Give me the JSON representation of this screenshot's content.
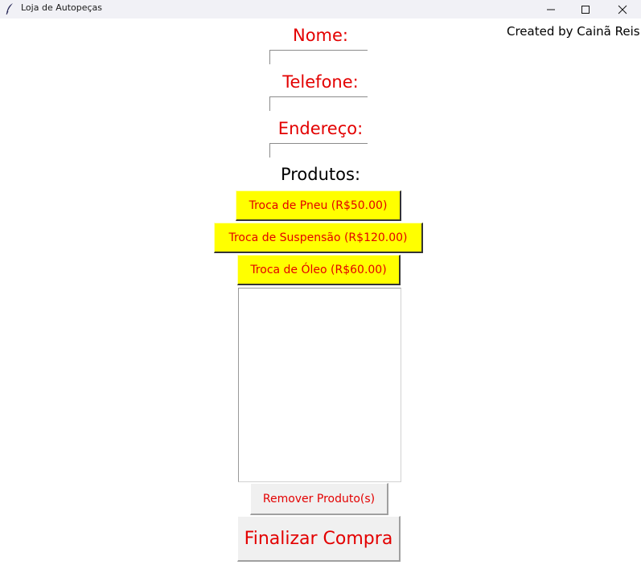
{
  "window": {
    "title": "Loja de Autopeças",
    "icon": "feather-icon",
    "controls": [
      "minimize-icon",
      "maximize-icon",
      "close-icon"
    ]
  },
  "credit": "Created by Cainã Reis",
  "form": {
    "name_label": "Nome:",
    "name_value": "",
    "phone_label": "Telefone:",
    "phone_value": "",
    "address_label": "Endereço:",
    "address_value": ""
  },
  "products": {
    "title": "Produtos:",
    "buttons": [
      {
        "label": "Troca de Pneu (R$50.00)"
      },
      {
        "label": "Troca de Suspensão (R$120.00)"
      },
      {
        "label": "Troca de Óleo (R$60.00)"
      }
    ],
    "selected_items": []
  },
  "actions": {
    "remove_label": "Remover Produto(s)",
    "checkout_label": "Finalizar Compra"
  },
  "colors": {
    "label_red": "#e30000",
    "product_button_bg": "#ffff00",
    "title_bar_bg": "#f1f1f6",
    "window_bg": "#ffffff"
  }
}
